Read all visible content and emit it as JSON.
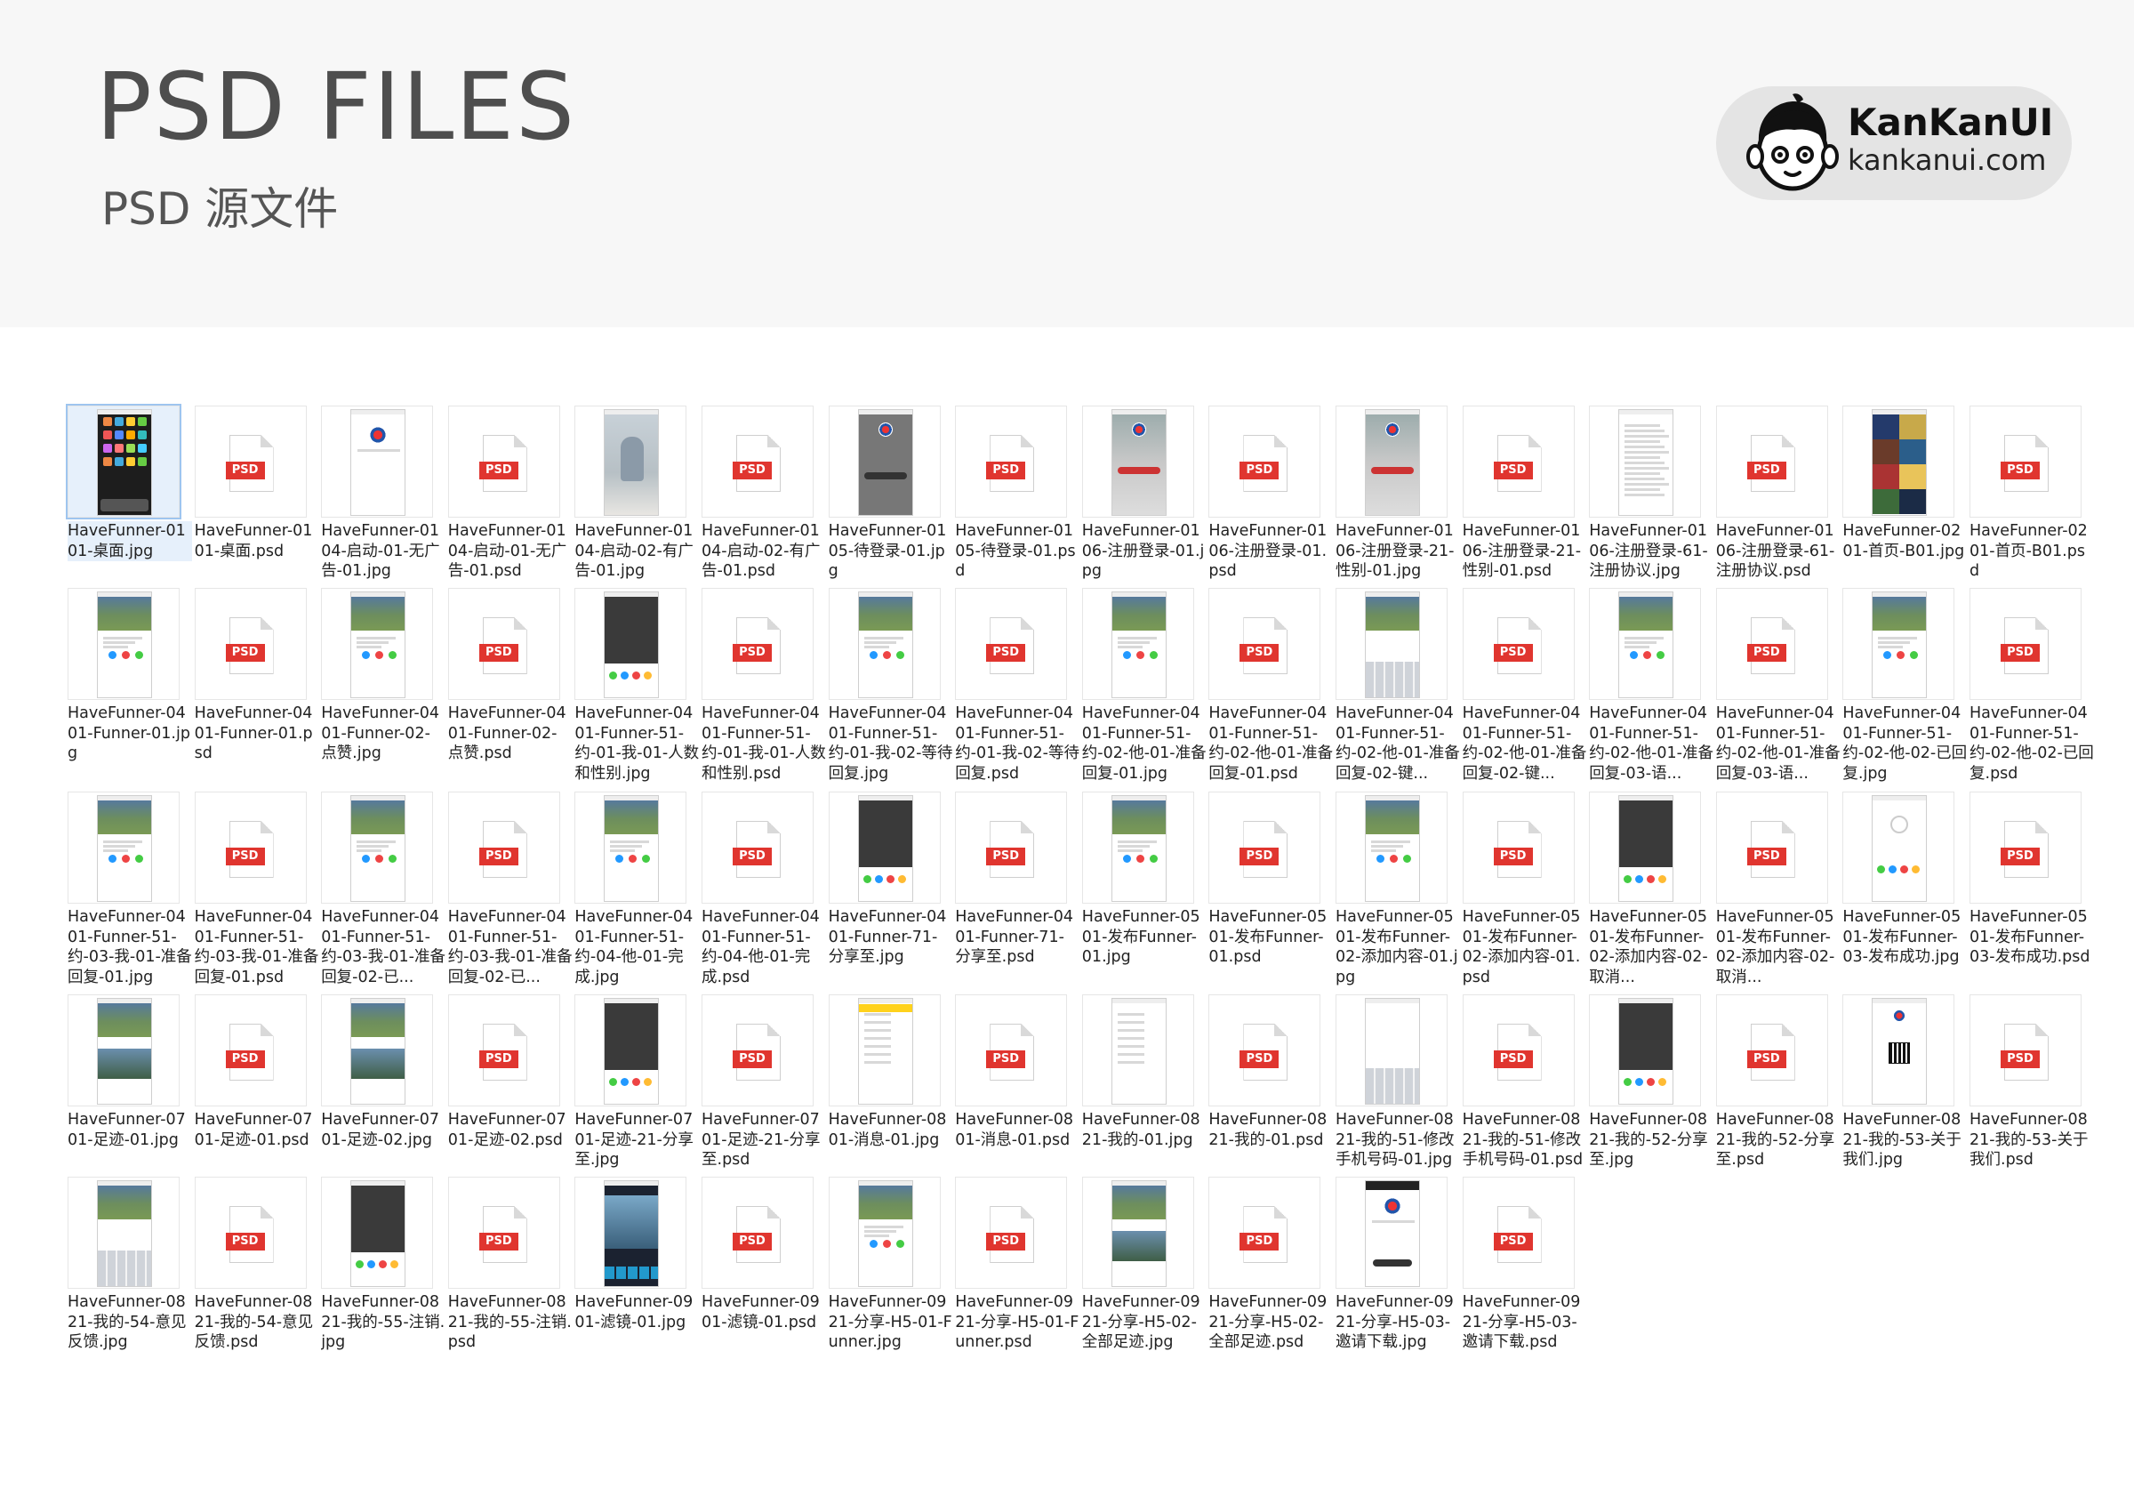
{
  "header": {
    "title": "PSD FILES",
    "subtitle": "PSD 源文件",
    "brand_name": "KanKanUI",
    "brand_url": "kankanui.com"
  },
  "colors": {
    "psd_badge": "#e0352f",
    "header_bg": "#f7f7f7",
    "selection": "#9ec5ef"
  },
  "badge_label": "PSD",
  "files": [
    {
      "name": "HaveFunner-0101-桌面.jpg",
      "type": "jpg",
      "thumb": "home",
      "selected": true
    },
    {
      "name": "HaveFunner-0101-桌面.psd",
      "type": "psd"
    },
    {
      "name": "HaveFunner-0104-启动-01-无广告-01.jpg",
      "type": "jpg",
      "thumb": "logo"
    },
    {
      "name": "HaveFunner-0104-启动-01-无广告-01.psd",
      "type": "psd"
    },
    {
      "name": "HaveFunner-0104-启动-02-有广告-01.jpg",
      "type": "jpg",
      "thumb": "photo"
    },
    {
      "name": "HaveFunner-0104-启动-02-有广告-01.psd",
      "type": "psd"
    },
    {
      "name": "HaveFunner-0105-待登录-01.jpg",
      "type": "jpg",
      "thumb": "login"
    },
    {
      "name": "HaveFunner-0105-待登录-01.psd",
      "type": "psd"
    },
    {
      "name": "HaveFunner-0106-注册登录-01.jpg",
      "type": "jpg",
      "thumb": "register"
    },
    {
      "name": "HaveFunner-0106-注册登录-01.psd",
      "type": "psd"
    },
    {
      "name": "HaveFunner-0106-注册登录-21-性别-01.jpg",
      "type": "jpg",
      "thumb": "register"
    },
    {
      "name": "HaveFunner-0106-注册登录-21-性别-01.psd",
      "type": "psd"
    },
    {
      "name": "HaveFunner-0106-注册登录-61-注册协议.jpg",
      "type": "jpg",
      "thumb": "text"
    },
    {
      "name": "HaveFunner-0106-注册登录-61-注册协议.psd",
      "type": "psd"
    },
    {
      "name": "HaveFunner-0201-首页-B01.jpg",
      "type": "jpg",
      "thumb": "collage"
    },
    {
      "name": "HaveFunner-0201-首页-B01.psd",
      "type": "psd"
    },
    {
      "name": "HaveFunner-0401-Funner-01.jpg",
      "type": "jpg",
      "thumb": "group"
    },
    {
      "name": "HaveFunner-0401-Funner-01.psd",
      "type": "psd"
    },
    {
      "name": "HaveFunner-0401-Funner-02-点赞.jpg",
      "type": "jpg",
      "thumb": "group"
    },
    {
      "name": "HaveFunner-0401-Funner-02-点赞.psd",
      "type": "psd"
    },
    {
      "name": "HaveFunner-0401-Funner-51-约-01-我-01-人数和性别.jpg",
      "type": "jpg",
      "thumb": "dark"
    },
    {
      "name": "HaveFunner-0401-Funner-51-约-01-我-01-人数和性别.psd",
      "type": "psd"
    },
    {
      "name": "HaveFunner-0401-Funner-51-约-01-我-02-等待回复.jpg",
      "type": "jpg",
      "thumb": "group"
    },
    {
      "name": "HaveFunner-0401-Funner-51-约-01-我-02-等待回复.psd",
      "type": "psd"
    },
    {
      "name": "HaveFunner-0401-Funner-51-约-02-他-01-准备回复-01.jpg",
      "type": "jpg",
      "thumb": "group"
    },
    {
      "name": "HaveFunner-0401-Funner-51-约-02-他-01-准备回复-01.psd",
      "type": "psd"
    },
    {
      "name": "HaveFunner-0401-Funner-51-约-02-他-01-准备回复-02-键...",
      "type": "jpg",
      "thumb": "keyboard"
    },
    {
      "name": "HaveFunner-0401-Funner-51-约-02-他-01-准备回复-02-键...",
      "type": "psd"
    },
    {
      "name": "HaveFunner-0401-Funner-51-约-02-他-01-准备回复-03-语...",
      "type": "jpg",
      "thumb": "group"
    },
    {
      "name": "HaveFunner-0401-Funner-51-约-02-他-01-准备回复-03-语...",
      "type": "psd"
    },
    {
      "name": "HaveFunner-0401-Funner-51-约-02-他-02-已回复.jpg",
      "type": "jpg",
      "thumb": "group"
    },
    {
      "name": "HaveFunner-0401-Funner-51-约-02-他-02-已回复.psd",
      "type": "psd"
    },
    {
      "name": "HaveFunner-0401-Funner-51-约-03-我-01-准备回复-01.jpg",
      "type": "jpg",
      "thumb": "group"
    },
    {
      "name": "HaveFunner-0401-Funner-51-约-03-我-01-准备回复-01.psd",
      "type": "psd"
    },
    {
      "name": "HaveFunner-0401-Funner-51-约-03-我-01-准备回复-02-已...",
      "type": "jpg",
      "thumb": "group"
    },
    {
      "name": "HaveFunner-0401-Funner-51-约-03-我-01-准备回复-02-已...",
      "type": "psd"
    },
    {
      "name": "HaveFunner-0401-Funner-51-约-04-他-01-完成.jpg",
      "type": "jpg",
      "thumb": "group"
    },
    {
      "name": "HaveFunner-0401-Funner-51-约-04-他-01-完成.psd",
      "type": "psd"
    },
    {
      "name": "HaveFunner-0401-Funner-71-分享至.jpg",
      "type": "jpg",
      "thumb": "dark"
    },
    {
      "name": "HaveFunner-0401-Funner-71-分享至.psd",
      "type": "psd"
    },
    {
      "name": "HaveFunner-0501-发布Funner-01.jpg",
      "type": "jpg",
      "thumb": "group"
    },
    {
      "name": "HaveFunner-0501-发布Funner-01.psd",
      "type": "psd"
    },
    {
      "name": "HaveFunner-0501-发布Funner-02-添加内容-01.jpg",
      "type": "jpg",
      "thumb": "group"
    },
    {
      "name": "HaveFunner-0501-发布Funner-02-添加内容-01.psd",
      "type": "psd"
    },
    {
      "name": "HaveFunner-0501-发布Funner-02-添加内容-02-取消...",
      "type": "jpg",
      "thumb": "dark"
    },
    {
      "name": "HaveFunner-0501-发布Funner-02-添加内容-02-取消...",
      "type": "psd"
    },
    {
      "name": "HaveFunner-0501-发布Funner-03-发布成功.jpg",
      "type": "jpg",
      "thumb": "success"
    },
    {
      "name": "HaveFunner-0501-发布Funner-03-发布成功.psd",
      "type": "psd"
    },
    {
      "name": "HaveFunner-0701-足迹-01.jpg",
      "type": "jpg",
      "thumb": "feed"
    },
    {
      "name": "HaveFunner-0701-足迹-01.psd",
      "type": "psd"
    },
    {
      "name": "HaveFunner-0701-足迹-02.jpg",
      "type": "jpg",
      "thumb": "feed"
    },
    {
      "name": "HaveFunner-0701-足迹-02.psd",
      "type": "psd"
    },
    {
      "name": "HaveFunner-0701-足迹-21-分享至.jpg",
      "type": "jpg",
      "thumb": "dark"
    },
    {
      "name": "HaveFunner-0701-足迹-21-分享至.psd",
      "type": "psd"
    },
    {
      "name": "HaveFunner-0801-消息-01.jpg",
      "type": "jpg",
      "thumb": "message"
    },
    {
      "name": "HaveFunner-0801-消息-01.psd",
      "type": "psd"
    },
    {
      "name": "HaveFunner-0821-我的-01.jpg",
      "type": "jpg",
      "thumb": "list"
    },
    {
      "name": "HaveFunner-0821-我的-01.psd",
      "type": "psd"
    },
    {
      "name": "HaveFunner-0821-我的-51-修改手机号码-01.jpg",
      "type": "jpg",
      "thumb": "numpad"
    },
    {
      "name": "HaveFunner-0821-我的-51-修改手机号码-01.psd",
      "type": "psd"
    },
    {
      "name": "HaveFunner-0821-我的-52-分享至.jpg",
      "type": "jpg",
      "thumb": "dark"
    },
    {
      "name": "HaveFunner-0821-我的-52-分享至.psd",
      "type": "psd"
    },
    {
      "name": "HaveFunner-0821-我的-53-关于我们.jpg",
      "type": "jpg",
      "thumb": "qr"
    },
    {
      "name": "HaveFunner-0821-我的-53-关于我们.psd",
      "type": "psd"
    },
    {
      "name": "HaveFunner-0821-我的-54-意见反馈.jpg",
      "type": "jpg",
      "thumb": "keyboard"
    },
    {
      "name": "HaveFunner-0821-我的-54-意见反馈.psd",
      "type": "psd"
    },
    {
      "name": "HaveFunner-0821-我的-55-注销.jpg",
      "type": "jpg",
      "thumb": "dark"
    },
    {
      "name": "HaveFunner-0821-我的-55-注销.psd",
      "type": "psd"
    },
    {
      "name": "HaveFunner-0901-滤镜-01.jpg",
      "type": "jpg",
      "thumb": "filter"
    },
    {
      "name": "HaveFunner-0901-滤镜-01.psd",
      "type": "psd"
    },
    {
      "name": "HaveFunner-0921-分享-H5-01-Funner.jpg",
      "type": "jpg",
      "thumb": "group"
    },
    {
      "name": "HaveFunner-0921-分享-H5-01-Funner.psd",
      "type": "psd"
    },
    {
      "name": "HaveFunner-0921-分享-H5-02-全部足迹.jpg",
      "type": "jpg",
      "thumb": "feed"
    },
    {
      "name": "HaveFunner-0921-分享-H5-02-全部足迹.psd",
      "type": "psd"
    },
    {
      "name": "HaveFunner-0921-分享-H5-03-邀请下载.jpg",
      "type": "jpg",
      "thumb": "invite"
    },
    {
      "name": "HaveFunner-0921-分享-H5-03-邀请下载.psd",
      "type": "psd"
    }
  ]
}
